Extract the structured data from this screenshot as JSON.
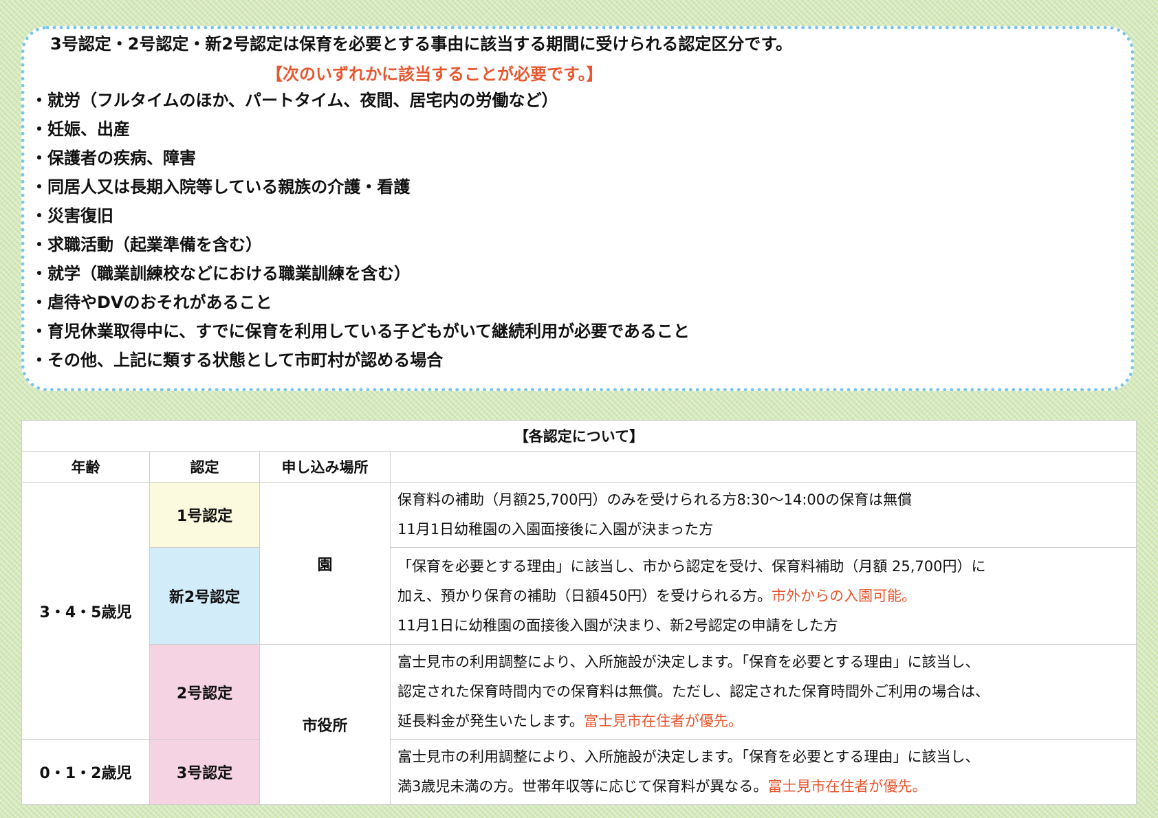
{
  "reasons_box": {
    "title": "3号認定・2号認定・新2号認定は保育を必要とする事由に該当する期間に受けられる認定区分です。",
    "note": "【次のいずれかに該当することが必要です。】",
    "items": [
      "・就労（フルタイムのほか、パートタイム、夜間、居宅内の労働など）",
      "・妊娠、出産",
      "・保護者の疾病、障害",
      "・同居人又は長期入院等している親族の介護・看護",
      "・災害復旧",
      "・求職活動（起業準備を含む）",
      "・就学（職業訓練校などにおける職業訓練を含む）",
      "・虐待やDVのおそれがあること",
      "・育児休業取得中に、すでに保育を利用している子どもがいて継続利用が必要であること",
      "・その他、上記に類する状態として市町村が認める場合"
    ]
  },
  "table": {
    "caption": "【各認定について】",
    "headers": {
      "age": "年齢",
      "cert": "認定",
      "place": "申し込み場所",
      "desc": ""
    },
    "ages": {
      "a345": "3・4・5歳児",
      "a012": "0・1・2歳児"
    },
    "places": {
      "kindergarten": "園",
      "city_hall": "市役所"
    },
    "rows": {
      "cert1": {
        "label": "1号認定",
        "line1": "保育料の補助（月額25,700円）のみを受けられる方8:30〜14:00の保育は無償",
        "line2": "11月1日幼稚園の入園面接後に入園が決まった方"
      },
      "new2": {
        "label": "新2号認定",
        "line1": "「保育を必要とする理由」に該当し、市から認定を受け、保育料補助（月額 25,700円）に",
        "line2": "加え、預かり保育の補助（日額450円）を受けられる方。",
        "line2_red": "市外からの入園可能。",
        "line3": "11月1日に幼稚園の面接後入園が決まり、新2号認定の申請をした方"
      },
      "cert2": {
        "label": "2号認定",
        "line1": "富士見市の利用調整により、入所施設が決定します。「保育を必要とする理由」に該当し、",
        "line2": "認定された保育時間内での保育料は無償。ただし、認定された保育時間外ご利用の場合は、",
        "line3": "延長料金が発生いたします。",
        "line3_red": "富士見市在住者が優先。"
      },
      "cert3": {
        "label": "3号認定",
        "line1": "富士見市の利用調整により、入所施設が決定します。「保育を必要とする理由」に該当し、",
        "line2": "満3歳児未満の方。世帯年収等に応じて保育料が異なる。",
        "line2_red": "富士見市在住者が優先。"
      }
    }
  },
  "colors": {
    "accent_red": "#e8562f",
    "dotted_border": "#79c6ea",
    "cert1_bg": "#fbf9de",
    "new2_bg": "#d3ecf9",
    "cert23_bg": "#f5d3e2",
    "page_bg": "#d4e8bb"
  }
}
